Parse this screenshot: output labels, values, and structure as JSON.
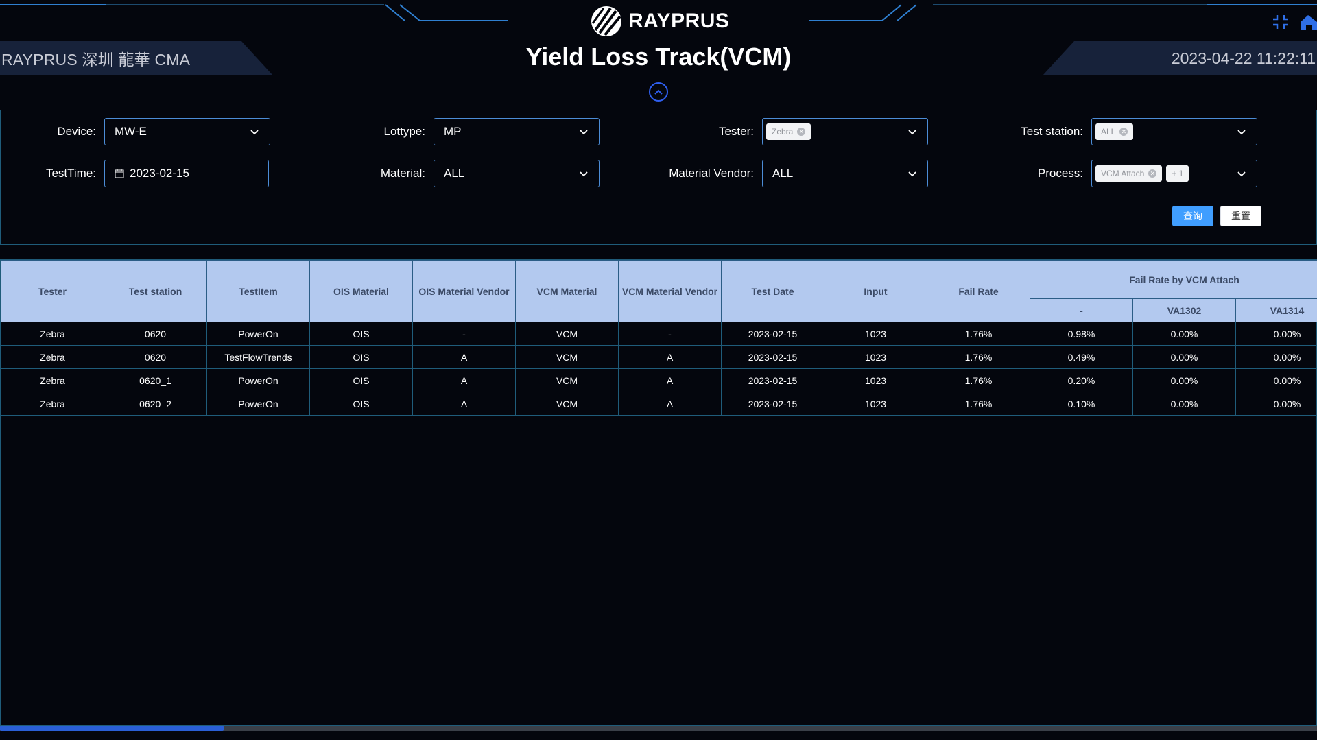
{
  "header": {
    "location": "RAYPRUS 深圳 龍華 CMA",
    "logo_text": "RAYPRUS",
    "title": "Yield Loss Track(VCM)",
    "datetime": "2023-04-22 11:22:11"
  },
  "icons": {
    "logo": "rayprus-logo-icon",
    "collapse": "chevron-up-icon",
    "fullscreen": "fullscreen-exit-icon",
    "home": "home-icon",
    "calendar": "calendar-icon",
    "dropdown": "chevron-down-icon"
  },
  "colors": {
    "background": "#04060d",
    "accent": "#409eff",
    "border": "#1f5c7a",
    "table_header": "#b3c9ef",
    "header_line": "#2f7fd0"
  },
  "filters": {
    "device": {
      "label": "Device:",
      "value": "MW-E"
    },
    "lottype": {
      "label": "Lottype:",
      "value": "MP"
    },
    "tester": {
      "label": "Tester:",
      "tag": "Zebra"
    },
    "test_station": {
      "label": "Test station:",
      "tag": "ALL"
    },
    "testtime": {
      "label": "TestTime:",
      "value": "2023-02-15"
    },
    "material": {
      "label": "Material:",
      "value": "ALL"
    },
    "material_vendor": {
      "label": "Material Vendor:",
      "value": "ALL"
    },
    "process": {
      "label": "Process:",
      "tag": "VCM Attach",
      "more": "+ 1"
    }
  },
  "buttons": {
    "query": "查询",
    "reset": "重置"
  },
  "table": {
    "columns": [
      "Tester",
      "Test station",
      "TestItem",
      "OIS Material",
      "OIS Material Vendor",
      "VCM Material",
      "VCM Material Vendor",
      "Test Date",
      "Input",
      "Fail Rate"
    ],
    "group_header": "Fail Rate by VCM Attach",
    "group_columns": [
      "-",
      "VA1302",
      "VA1314"
    ],
    "rows": [
      [
        "Zebra",
        "0620",
        "PowerOn",
        "OIS",
        "-",
        "VCM",
        "-",
        "2023-02-15",
        "1023",
        "1.76%",
        "0.98%",
        "0.00%",
        "0.00%"
      ],
      [
        "Zebra",
        "0620",
        "TestFlowTrends",
        "OIS",
        "A",
        "VCM",
        "A",
        "2023-02-15",
        "1023",
        "1.76%",
        "0.49%",
        "0.00%",
        "0.00%"
      ],
      [
        "Zebra",
        "0620_1",
        "PowerOn",
        "OIS",
        "A",
        "VCM",
        "A",
        "2023-02-15",
        "1023",
        "1.76%",
        "0.20%",
        "0.00%",
        "0.00%"
      ],
      [
        "Zebra",
        "0620_2",
        "PowerOn",
        "OIS",
        "A",
        "VCM",
        "A",
        "2023-02-15",
        "1023",
        "1.76%",
        "0.10%",
        "0.00%",
        "0.00%"
      ]
    ]
  },
  "scroll": {
    "position_fraction": 0.17
  }
}
